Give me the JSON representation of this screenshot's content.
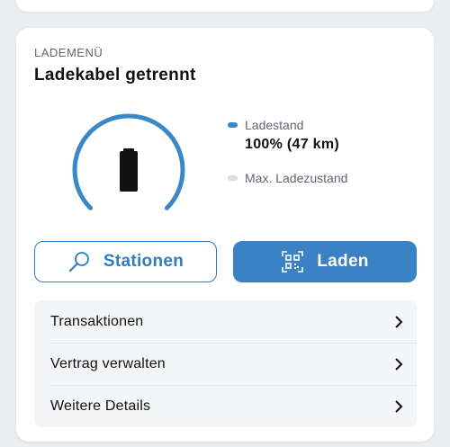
{
  "card": {
    "section_label": "LADEMENÜ",
    "title": "Ladekabel getrennt"
  },
  "gauge": {
    "charge_level_percent": 100,
    "icon": "battery-icon"
  },
  "legend": {
    "charge_label": "Ladestand",
    "charge_value": "100% (47 km)",
    "max_label": "Max. Ladezustand",
    "charge_color": "#3b88c8",
    "max_color": "#dcdfe3"
  },
  "buttons": {
    "stations_label": "Stationen",
    "stations_icon": "search-icon",
    "charge_label": "Laden",
    "charge_icon": "qr-scan-icon"
  },
  "colors": {
    "accent": "#2e7cc1",
    "accent_fill": "#3b82c4"
  },
  "menu": {
    "items": [
      {
        "label": "Transaktionen",
        "icon": "chevron-right-icon"
      },
      {
        "label": "Vertrag verwalten",
        "icon": "chevron-right-icon"
      },
      {
        "label": "Weitere Details",
        "icon": "chevron-right-icon"
      }
    ]
  }
}
